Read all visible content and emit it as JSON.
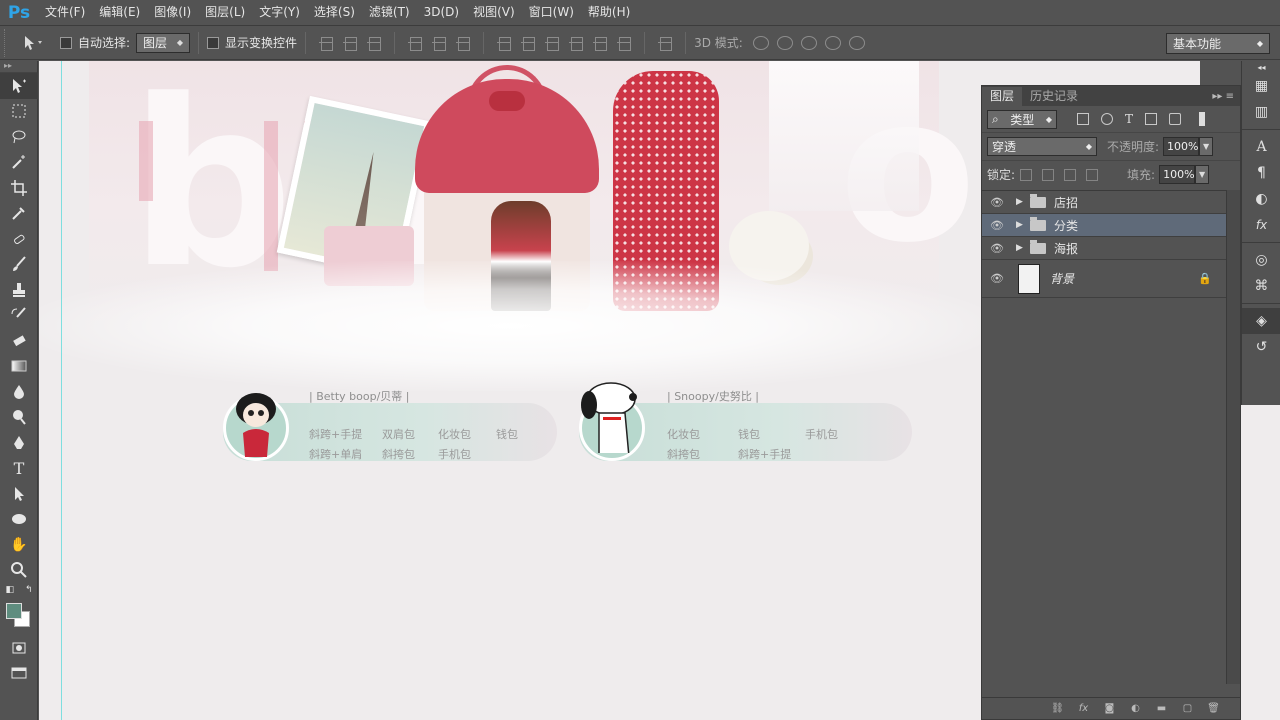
{
  "app": {
    "logo": "Ps"
  },
  "menu": [
    "文件(F)",
    "编辑(E)",
    "图像(I)",
    "图层(L)",
    "文字(Y)",
    "选择(S)",
    "滤镜(T)",
    "3D(D)",
    "视图(V)",
    "窗口(W)",
    "帮助(H)"
  ],
  "options": {
    "auto_select_label": "自动选择:",
    "auto_select_value": "图层",
    "show_transform_label": "显示变换控件",
    "mode_3d_label": "3D 模式:",
    "workspace": "基本功能"
  },
  "canvas": {
    "categories": [
      {
        "title": "|   Betty boop/贝蒂   |",
        "links": [
          "斜跨+手提",
          "双肩包",
          "化妆包",
          "钱包",
          "斜跨+单肩",
          "斜挎包",
          "手机包"
        ]
      },
      {
        "title": "|   Snoopy/史努比   |",
        "links": [
          "化妆包",
          "钱包",
          "手机包",
          "斜挎包",
          "斜跨+手提"
        ]
      }
    ]
  },
  "layers_panel": {
    "tabs": [
      "图层",
      "历史记录"
    ],
    "filter_kind": "类型",
    "blend_mode": "穿透",
    "opacity_label": "不透明度:",
    "opacity_value": "100%",
    "lock_label": "锁定:",
    "fill_label": "填充:",
    "fill_value": "100%",
    "layers": [
      {
        "name": "店招",
        "type": "group",
        "selected": false
      },
      {
        "name": "分类",
        "type": "group",
        "selected": true
      },
      {
        "name": "海报",
        "type": "group",
        "selected": false
      },
      {
        "name": "背景",
        "type": "layer",
        "selected": false,
        "locked": true
      }
    ]
  },
  "colors": {
    "foreground": "#5f8d7f",
    "background": "#ffffff",
    "ui_bg": "#535353",
    "selected_layer": "#5f6a79"
  }
}
